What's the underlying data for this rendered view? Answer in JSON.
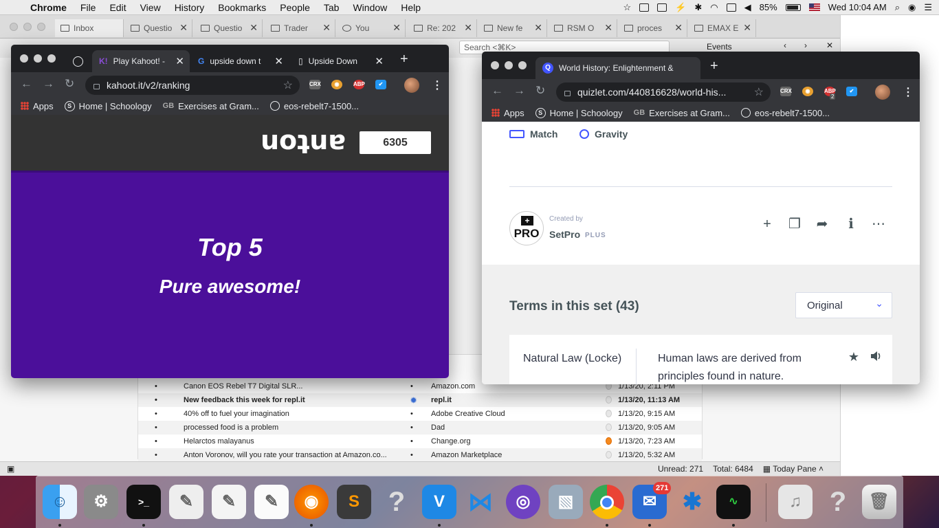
{
  "menubar": {
    "app": "Chrome",
    "items": [
      "File",
      "Edit",
      "View",
      "History",
      "Bookmarks",
      "People",
      "Tab",
      "Window",
      "Help"
    ],
    "battery": "85%",
    "clock": "Wed 10:04 AM"
  },
  "thunderbird": {
    "tabs": [
      "Inbox",
      "Questio",
      "Questio",
      "Trader",
      "You",
      "Re: 202",
      "New fe",
      "RSM O",
      "proces",
      "EMAX E"
    ],
    "search_placeholder": "Search <⌘K>",
    "events_label": "Events",
    "messages": [
      {
        "subject": "Canon EOS Rebel T7 Digital SLR...",
        "from": "Amazon.com",
        "date": "1/13/20, 2:11 PM",
        "bold": false,
        "hot": false
      },
      {
        "subject": "New feedback this week for repl.it",
        "from": "repl.it",
        "date": "1/13/20, 11:13 AM",
        "bold": true,
        "hot": false
      },
      {
        "subject": "40% off to fuel your imagination",
        "from": "Adobe Creative Cloud",
        "date": "1/13/20, 9:15 AM",
        "bold": false,
        "hot": false
      },
      {
        "subject": "processed food is a problem",
        "from": "Dad",
        "date": "1/13/20, 9:05 AM",
        "bold": false,
        "hot": false
      },
      {
        "subject": "Helarctos malayanus",
        "from": "Change.org",
        "date": "1/13/20, 7:23 AM",
        "bold": false,
        "hot": true
      },
      {
        "subject": "Anton Voronov, will you rate your transaction at Amazon.co...",
        "from": "Amazon Marketplace",
        "date": "1/13/20, 5:32 AM",
        "bold": false,
        "hot": false
      }
    ],
    "status": {
      "unread": "Unread: 271",
      "total": "Total: 6484",
      "today_pane": "Today Pane"
    }
  },
  "kahoot_window": {
    "tabs": [
      {
        "title": "Play Kahoot! -"
      },
      {
        "title": "upside down t"
      },
      {
        "title": "Upside Down"
      }
    ],
    "url": "kahoot.it/v2/ranking",
    "bookmarks": [
      "Apps",
      "Home | Schoology",
      "Exercises at Gram...",
      "eos-rebelt7-1500..."
    ],
    "nickname": "anton",
    "score": "6305",
    "headline": "Top 5",
    "subline": "Pure awesome!"
  },
  "quizlet_window": {
    "tab_title": "World History: Enlightenment &",
    "url": "quizlet.com/440816628/world-his...",
    "bookmarks": [
      "Apps",
      "Home | Schoology",
      "Exercises at Gram...",
      "eos-rebelt7-1500..."
    ],
    "abp_count": "2",
    "modes": [
      "Match",
      "Gravity"
    ],
    "created_by_label": "Created by",
    "author": "SetPro",
    "author_badge": "PLUS",
    "pro_label": "PRO",
    "terms_heading": "Terms in this set (43)",
    "sort_option": "Original",
    "first_term": "Natural Law (Locke)",
    "first_definition": "Human laws are derived from principles found in nature."
  },
  "dock": {
    "mail_badge": "271"
  }
}
